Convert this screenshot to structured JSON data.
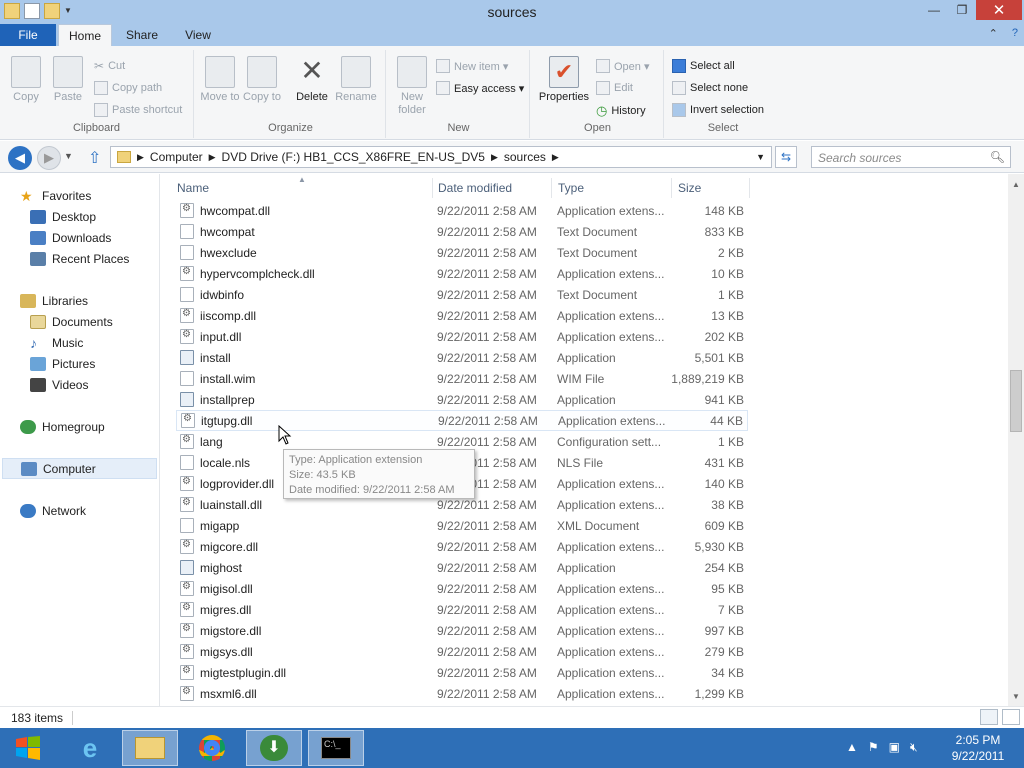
{
  "window": {
    "title": "sources",
    "minimize": "—",
    "restore": "❐",
    "close": "✕"
  },
  "tabs": {
    "file": "File",
    "home": "Home",
    "share": "Share",
    "view": "View"
  },
  "ribbon": {
    "clipboard": {
      "label": "Clipboard",
      "copy": "Copy",
      "paste": "Paste",
      "cut": "Cut",
      "copy_path": "Copy path",
      "paste_shortcut": "Paste shortcut"
    },
    "organize": {
      "label": "Organize",
      "move_to": "Move to",
      "copy_to": "Copy to",
      "delete": "Delete",
      "rename": "Rename"
    },
    "new": {
      "label": "New",
      "new_folder": "New folder",
      "new_item": "New item ▾",
      "easy_access": "Easy access ▾"
    },
    "open": {
      "label": "Open",
      "properties": "Properties",
      "open": "Open ▾",
      "edit": "Edit",
      "history": "History"
    },
    "select": {
      "label": "Select",
      "select_all": "Select all",
      "select_none": "Select none",
      "invert_selection": "Invert selection"
    }
  },
  "address": {
    "crumbs": [
      "Computer",
      "DVD Drive (F:) HB1_CCS_X86FRE_EN-US_DV5",
      "sources"
    ],
    "search_placeholder": "Search sources"
  },
  "nav_pane": {
    "favorites": "Favorites",
    "desktop": "Desktop",
    "downloads": "Downloads",
    "recent_places": "Recent Places",
    "libraries": "Libraries",
    "documents": "Documents",
    "music": "Music",
    "pictures": "Pictures",
    "videos": "Videos",
    "homegroup": "Homegroup",
    "computer": "Computer",
    "network": "Network"
  },
  "columns": {
    "name": "Name",
    "date": "Date modified",
    "type": "Type",
    "size": "Size"
  },
  "files": [
    {
      "name": "hwcompat.dll",
      "date": "9/22/2011 2:58 AM",
      "type": "Application extens...",
      "size": "148 KB",
      "icon": "dll"
    },
    {
      "name": "hwcompat",
      "date": "9/22/2011 2:58 AM",
      "type": "Text Document",
      "size": "833 KB",
      "icon": "txt"
    },
    {
      "name": "hwexclude",
      "date": "9/22/2011 2:58 AM",
      "type": "Text Document",
      "size": "2 KB",
      "icon": "txt"
    },
    {
      "name": "hypervcomplcheck.dll",
      "date": "9/22/2011 2:58 AM",
      "type": "Application extens...",
      "size": "10 KB",
      "icon": "dll"
    },
    {
      "name": "idwbinfo",
      "date": "9/22/2011 2:58 AM",
      "type": "Text Document",
      "size": "1 KB",
      "icon": "txt"
    },
    {
      "name": "iiscomp.dll",
      "date": "9/22/2011 2:58 AM",
      "type": "Application extens...",
      "size": "13 KB",
      "icon": "dll"
    },
    {
      "name": "input.dll",
      "date": "9/22/2011 2:58 AM",
      "type": "Application extens...",
      "size": "202 KB",
      "icon": "dll"
    },
    {
      "name": "install",
      "date": "9/22/2011 2:58 AM",
      "type": "Application",
      "size": "5,501 KB",
      "icon": "app"
    },
    {
      "name": "install.wim",
      "date": "9/22/2011 2:58 AM",
      "type": "WIM File",
      "size": "1,889,219 KB",
      "icon": "txt"
    },
    {
      "name": "installprep",
      "date": "9/22/2011 2:58 AM",
      "type": "Application",
      "size": "941 KB",
      "icon": "app"
    },
    {
      "name": "itgtupg.dll",
      "date": "9/22/2011 2:58 AM",
      "type": "Application extens...",
      "size": "44 KB",
      "icon": "dll"
    },
    {
      "name": "lang",
      "date": "9/22/2011 2:58 AM",
      "type": "Configuration sett...",
      "size": "1 KB",
      "icon": "dll"
    },
    {
      "name": "locale.nls",
      "date": "9/22/2011 2:58 AM",
      "type": "NLS File",
      "size": "431 KB",
      "icon": "txt"
    },
    {
      "name": "logprovider.dll",
      "date": "9/22/2011 2:58 AM",
      "type": "Application extens...",
      "size": "140 KB",
      "icon": "dll"
    },
    {
      "name": "luainstall.dll",
      "date": "9/22/2011 2:58 AM",
      "type": "Application extens...",
      "size": "38 KB",
      "icon": "dll"
    },
    {
      "name": "migapp",
      "date": "9/22/2011 2:58 AM",
      "type": "XML Document",
      "size": "609 KB",
      "icon": "txt"
    },
    {
      "name": "migcore.dll",
      "date": "9/22/2011 2:58 AM",
      "type": "Application extens...",
      "size": "5,930 KB",
      "icon": "dll"
    },
    {
      "name": "mighost",
      "date": "9/22/2011 2:58 AM",
      "type": "Application",
      "size": "254 KB",
      "icon": "app"
    },
    {
      "name": "migisol.dll",
      "date": "9/22/2011 2:58 AM",
      "type": "Application extens...",
      "size": "95 KB",
      "icon": "dll"
    },
    {
      "name": "migres.dll",
      "date": "9/22/2011 2:58 AM",
      "type": "Application extens...",
      "size": "7 KB",
      "icon": "dll"
    },
    {
      "name": "migstore.dll",
      "date": "9/22/2011 2:58 AM",
      "type": "Application extens...",
      "size": "997 KB",
      "icon": "dll"
    },
    {
      "name": "migsys.dll",
      "date": "9/22/2011 2:58 AM",
      "type": "Application extens...",
      "size": "279 KB",
      "icon": "dll"
    },
    {
      "name": "migtestplugin.dll",
      "date": "9/22/2011 2:58 AM",
      "type": "Application extens...",
      "size": "34 KB",
      "icon": "dll"
    },
    {
      "name": "msxml6.dll",
      "date": "9/22/2011 2:58 AM",
      "type": "Application extens...",
      "size": "1,299 KB",
      "icon": "dll"
    }
  ],
  "hovered_file": "itgtupg.dll",
  "tooltip": {
    "type": "Type: Application extension",
    "size": "Size: 43.5 KB",
    "date": "Date modified: 9/22/2011 2:58 AM"
  },
  "status": {
    "item_count": "183 items"
  },
  "taskbar": {
    "time": "2:05 PM",
    "date": "9/22/2011"
  },
  "colors": {
    "accent": "#1f63b8",
    "titlebar": "#a9c8ea",
    "taskbar": "#2e6fb7",
    "close": "#c7413a"
  }
}
